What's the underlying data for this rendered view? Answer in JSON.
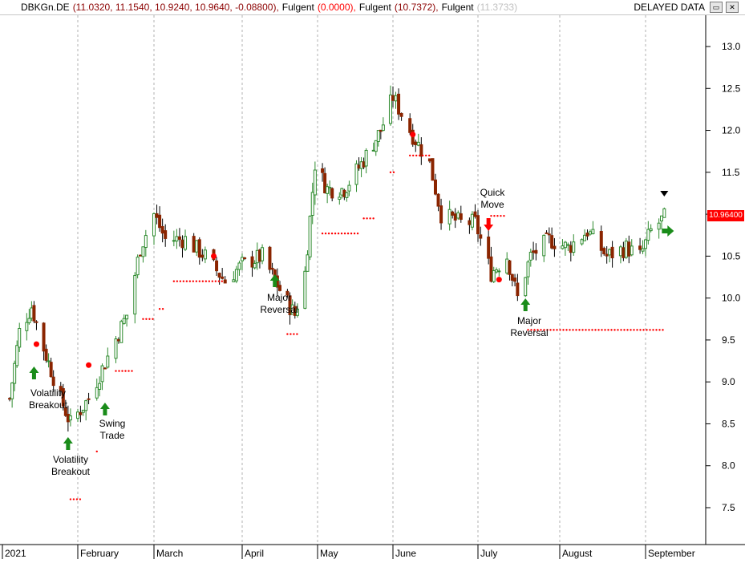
{
  "window": {
    "symbol": "DBKGn.DE",
    "ohlc": "(11.0320, 11.1540, 10.9240, 10.9640, -0.08800),",
    "ind1_name": "Fulgent",
    "ind1_val": "(0.0000),",
    "ind2_name": "Fulgent",
    "ind2_val": "(10.7372),",
    "ind3_name": "Fulgent",
    "ind3_val": "(11.3733)",
    "delayed": "DELAYED DATA",
    "minimize_glyph": "▭",
    "close_glyph": "✕",
    "last_price": "10.96400"
  },
  "colors": {
    "up": "#2e8b2e",
    "down": "#8b2500",
    "grid": "#b0b0b0",
    "dots": "#ff0000",
    "arrow_up": "#1a8c1a",
    "arrow_down": "#ff0000"
  },
  "chart_data": {
    "type": "candlestick",
    "title": "DBKGn.DE",
    "ylim": [
      7.0,
      13.3
    ],
    "y_ticks": [
      "13.0",
      "12.5",
      "12.0",
      "11.5",
      "11.0",
      "10.5",
      "10.0",
      "9.5",
      "9.0",
      "8.5",
      "8.0",
      "7.5"
    ],
    "x_labels": [
      "2021",
      "February",
      "March",
      "April",
      "May",
      "June",
      "July",
      "August",
      "September"
    ],
    "annotations": [
      {
        "text": "Volatility",
        "line2": "Breakout",
        "kind": "buy"
      },
      {
        "text": "Volatility",
        "line2": "Breakout",
        "kind": "buy"
      },
      {
        "text": "Swing",
        "line2": "Trade",
        "kind": "buy"
      },
      {
        "text": "Major",
        "line2": "Reversal",
        "kind": "buy"
      },
      {
        "text": "Quick",
        "line2": "Move",
        "kind": "sell"
      },
      {
        "text": "Major",
        "line2": "Reversal",
        "kind": "buy"
      }
    ],
    "last_close": 10.964,
    "anchors": [
      [
        "2021-01-04",
        8.8
      ],
      [
        "2021-01-08",
        9.6
      ],
      [
        "2021-01-13",
        9.9
      ],
      [
        "2021-01-18",
        9.4
      ],
      [
        "2021-01-25",
        8.8
      ],
      [
        "2021-01-29",
        8.5
      ],
      [
        "2021-02-05",
        8.8
      ],
      [
        "2021-02-12",
        9.3
      ],
      [
        "2021-02-19",
        9.8
      ],
      [
        "2021-02-24",
        10.6
      ],
      [
        "2021-03-01",
        11.0
      ],
      [
        "2021-03-05",
        10.7
      ],
      [
        "2021-03-12",
        10.7
      ],
      [
        "2021-03-19",
        10.5
      ],
      [
        "2021-03-26",
        10.2
      ],
      [
        "2021-04-01",
        10.4
      ],
      [
        "2021-04-09",
        10.5
      ],
      [
        "2021-04-16",
        10.1
      ],
      [
        "2021-04-22",
        9.8
      ],
      [
        "2021-04-26",
        10.3
      ],
      [
        "2021-04-30",
        11.6
      ],
      [
        "2021-05-05",
        11.3
      ],
      [
        "2021-05-12",
        11.3
      ],
      [
        "2021-05-19",
        11.6
      ],
      [
        "2021-05-27",
        12.0
      ],
      [
        "2021-06-01",
        12.4
      ],
      [
        "2021-06-07",
        12.0
      ],
      [
        "2021-06-14",
        11.6
      ],
      [
        "2021-06-18",
        11.0
      ],
      [
        "2021-06-25",
        10.9
      ],
      [
        "2021-06-30",
        10.9
      ],
      [
        "2021-07-06",
        10.3
      ],
      [
        "2021-07-12",
        10.5
      ],
      [
        "2021-07-16",
        10.0
      ],
      [
        "2021-07-21",
        10.5
      ],
      [
        "2021-07-28",
        10.7
      ],
      [
        "2021-08-04",
        10.6
      ],
      [
        "2021-08-11",
        10.8
      ],
      [
        "2021-08-18",
        10.5
      ],
      [
        "2021-08-25",
        10.6
      ],
      [
        "2021-08-30",
        10.5
      ],
      [
        "2021-09-03",
        10.8
      ],
      [
        "2021-09-08",
        10.96
      ]
    ],
    "stop_lines": [
      {
        "from": "2021-01-29",
        "to": "2021-02-02",
        "value": 7.6
      },
      {
        "from": "2021-02-08",
        "to": "2021-02-09",
        "value": 8.17
      },
      {
        "from": "2021-02-15",
        "to": "2021-02-22",
        "value": 9.13
      },
      {
        "from": "2021-02-25",
        "to": "2021-03-01",
        "value": 9.75
      },
      {
        "from": "2021-03-03",
        "to": "2021-03-05",
        "value": 9.87
      },
      {
        "from": "2021-03-08",
        "to": "2021-03-26",
        "value": 10.2
      },
      {
        "from": "2021-04-19",
        "to": "2021-04-23",
        "value": 9.57
      },
      {
        "from": "2021-05-03",
        "to": "2021-05-18",
        "value": 10.77
      },
      {
        "from": "2021-05-20",
        "to": "2021-05-24",
        "value": 10.95
      },
      {
        "from": "2021-05-31",
        "to": "2021-06-02",
        "value": 11.5
      },
      {
        "from": "2021-06-07",
        "to": "2021-06-14",
        "value": 11.7
      },
      {
        "from": "2021-07-06",
        "to": "2021-07-12",
        "value": 10.98
      },
      {
        "from": "2021-07-20",
        "to": "2021-09-08",
        "value": 9.62
      }
    ]
  }
}
